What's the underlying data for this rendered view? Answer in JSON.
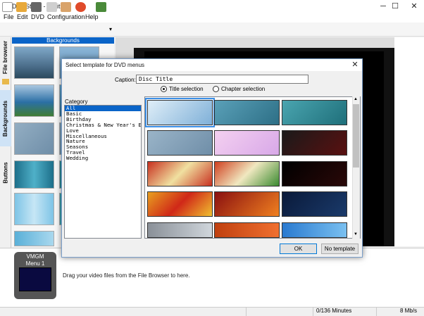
{
  "window": {
    "title": "DVDStyler - Untitled*",
    "minimize": "─",
    "maximize": "☐",
    "close": "✕"
  },
  "menu": [
    "File",
    "Edit",
    "DVD",
    "Configuration",
    "Help"
  ],
  "toolbar": {
    "icons": [
      "new-icon",
      "open-icon",
      "save-icon",
      "settings-icon",
      "tools-icon",
      "burn-icon",
      "add-icon",
      "dropdown-icon"
    ]
  },
  "side_tabs": {
    "file_browser": "File browser",
    "backgrounds": "Backgrounds",
    "buttons": "Buttons"
  },
  "backgrounds_panel": {
    "header": "Backgrounds"
  },
  "bottom": {
    "vmgm": "VMGM",
    "menu1": "Menu 1",
    "hint": "Drag your video files from the File Browser to here."
  },
  "status": {
    "minutes": "0/136 Minutes",
    "rate": "8 Mb/s"
  },
  "dialog": {
    "title": "Select template for DVD menus",
    "caption_label": "Caption:",
    "caption_value": "Disc Title",
    "radio_title": "Title selection",
    "radio_chapter": "Chapter selection",
    "category_label": "Category",
    "categories": [
      "All",
      "Basic",
      "Birthday",
      "Christmas & New Year's Ev",
      "Love",
      "Miscellaneous",
      "Nature",
      "Seasons",
      "Travel",
      "Wedding"
    ],
    "ok": "OK",
    "no_template": "No template"
  },
  "colors": {
    "accent": "#0a64c8",
    "selection": "#3a8ee6"
  }
}
